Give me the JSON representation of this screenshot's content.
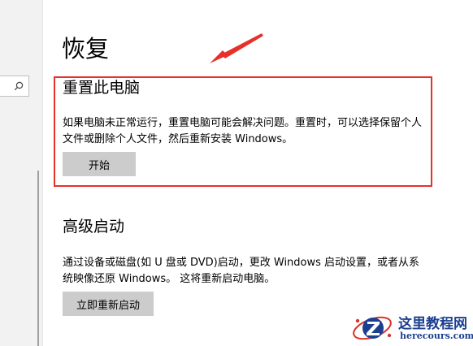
{
  "page": {
    "title": "恢复"
  },
  "reset_section": {
    "title": "重置此电脑",
    "description": "如果电脑未正常运行，重置电脑可能会解决问题。重置时，可以选择保留个人文件或删除个人文件，然后重新安装 Windows。",
    "button_label": "开始"
  },
  "advanced_section": {
    "title": "高级启动",
    "description": "通过设备或磁盘(如 U 盘或 DVD)启动，更改 Windows 启动设置，或者从系统映像还原 Windows。 这将重新启动电脑。",
    "button_label": "立即重新启动"
  },
  "watermark": {
    "name": "这里教程网",
    "url": "herecours.com"
  },
  "colors": {
    "annotation_red": "#e8302a",
    "button_gray": "#cccccc",
    "watermark_blue": "#1c3f8f"
  }
}
